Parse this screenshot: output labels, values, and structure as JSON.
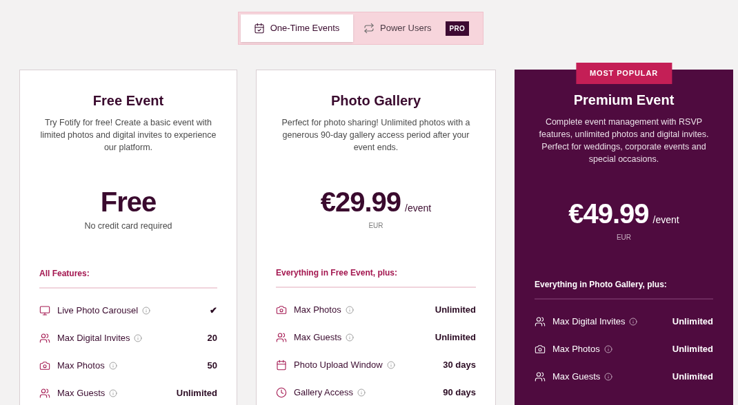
{
  "tabs": [
    {
      "label": "One-Time Events",
      "kind": "calendar",
      "selected": true
    },
    {
      "label": "Power Users",
      "kind": "repeat",
      "badge": "PRO",
      "selected": false
    }
  ],
  "plans": [
    {
      "name": "Free Event",
      "featured": false,
      "description": "Try Fotify for free! Create a basic event with limited photos and digital invites to experience our platform.",
      "price": "Free",
      "note": "No credit card required",
      "features_heading": "All Features:",
      "features": [
        {
          "kind": "display",
          "label": "Live Photo Carousel",
          "value": "✔"
        },
        {
          "kind": "people",
          "label": "Max Digital Invites",
          "value": "20"
        },
        {
          "kind": "camera",
          "label": "Max Photos",
          "value": "50"
        },
        {
          "kind": "people",
          "label": "Max Guests",
          "value": "Unlimited"
        }
      ]
    },
    {
      "name": "Photo Gallery",
      "featured": false,
      "description": "Perfect for photo sharing! Unlimited photos with a generous 90-day gallery access period after your event ends.",
      "price": "€29.99",
      "period": "/event",
      "currency": "EUR",
      "features_heading": "Everything in Free Event, plus:",
      "features": [
        {
          "kind": "camera",
          "label": "Max Photos",
          "value": "Unlimited"
        },
        {
          "kind": "people",
          "label": "Max Guests",
          "value": "Unlimited"
        },
        {
          "kind": "calendar",
          "label": "Photo Upload Window",
          "value": "30 days"
        },
        {
          "kind": "clock",
          "label": "Gallery Access",
          "value": "90 days"
        }
      ]
    },
    {
      "name": "Premium Event",
      "featured": true,
      "badge": "MOST POPULAR",
      "description": "Complete event management with RSVP features, unlimited photos and digital invites. Perfect for weddings, corporate events and special occasions.",
      "price": "€49.99",
      "period": "/event",
      "currency": "EUR",
      "features_heading": "Everything in Photo Gallery, plus:",
      "features": [
        {
          "kind": "people",
          "label": "Max Digital Invites",
          "value": "Unlimited"
        },
        {
          "kind": "camera",
          "label": "Max Photos",
          "value": "Unlimited"
        },
        {
          "kind": "people",
          "label": "Max Guests",
          "value": "Unlimited"
        }
      ]
    }
  ]
}
